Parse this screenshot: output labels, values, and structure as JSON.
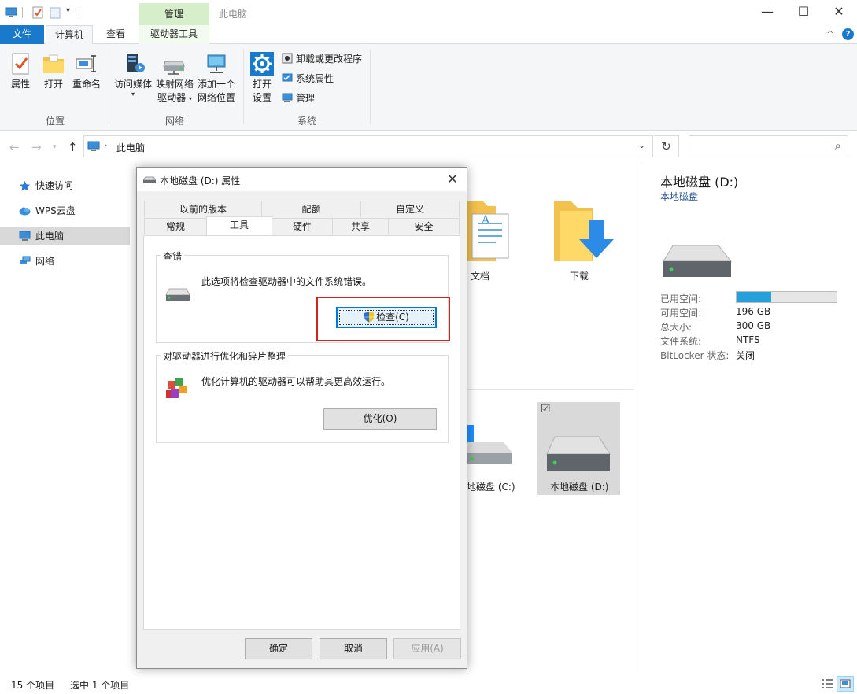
{
  "window": {
    "contextual_tab_header": "管理",
    "title": "此电脑",
    "minimize": "—",
    "maximize": "☐",
    "close": "✕"
  },
  "ribbon_tabs": {
    "file": "文件",
    "computer": "计算机",
    "view": "查看",
    "drive_tools": "驱动器工具",
    "collapse": "^",
    "help": "?"
  },
  "ribbon": {
    "location": {
      "label": "位置",
      "properties": "属性",
      "open": "打开",
      "rename": "重命名"
    },
    "network": {
      "label": "网络",
      "access_media": "访问媒体",
      "map_drive_1": "映射网络",
      "map_drive_2": "驱动器",
      "add_location_1": "添加一个",
      "add_location_2": "网络位置"
    },
    "system": {
      "label": "系统",
      "open_settings_1": "打开",
      "open_settings_2": "设置",
      "uninstall": "卸载或更改程序",
      "sys_props": "系统属性",
      "manage": "管理"
    }
  },
  "address": {
    "path": "此电脑",
    "refresh": "↻",
    "search_icon": "⌕"
  },
  "nav": {
    "items": [
      {
        "label": "快速访问"
      },
      {
        "label": "WPS云盘"
      },
      {
        "label": "此电脑"
      },
      {
        "label": "网络"
      }
    ]
  },
  "content": {
    "documents": "文档",
    "downloads": "下载",
    "drive_c": "地磁盘 (C:)",
    "drive_d": "本地磁盘 (D:)",
    "checkbox": "☑"
  },
  "details": {
    "title": "本地磁盘 (D:)",
    "subtitle": "本地磁盘",
    "used_label": "已用空间:",
    "used_fraction": 0.35,
    "free_label": "可用空间:",
    "free_value": "196 GB",
    "total_label": "总大小:",
    "total_value": "300 GB",
    "fs_label": "文件系统:",
    "fs_value": "NTFS",
    "bitlocker_label": "BitLocker 状态:",
    "bitlocker_value": "关闭"
  },
  "status": {
    "items": "15 个项目",
    "selected": "选中 1 个项目"
  },
  "dialog": {
    "title": "本地磁盘 (D:) 属性",
    "close": "✕",
    "tabs_row1": [
      "以前的版本",
      "配额",
      "自定义"
    ],
    "tabs_row2": [
      "常规",
      "工具",
      "硬件",
      "共享",
      "安全"
    ],
    "error_check": {
      "title": "查错",
      "text": "此选项将检查驱动器中的文件系统错误。",
      "button": "检查(C)"
    },
    "optimize": {
      "title": "对驱动器进行优化和碎片整理",
      "text": "优化计算机的驱动器可以帮助其更高效运行。",
      "button": "优化(O)"
    },
    "ok": "确定",
    "cancel": "取消",
    "apply": "应用(A)"
  },
  "colors": {
    "accent": "#1979ca",
    "highlight_box": "#d32222",
    "usage_bar": "#26a0da"
  }
}
